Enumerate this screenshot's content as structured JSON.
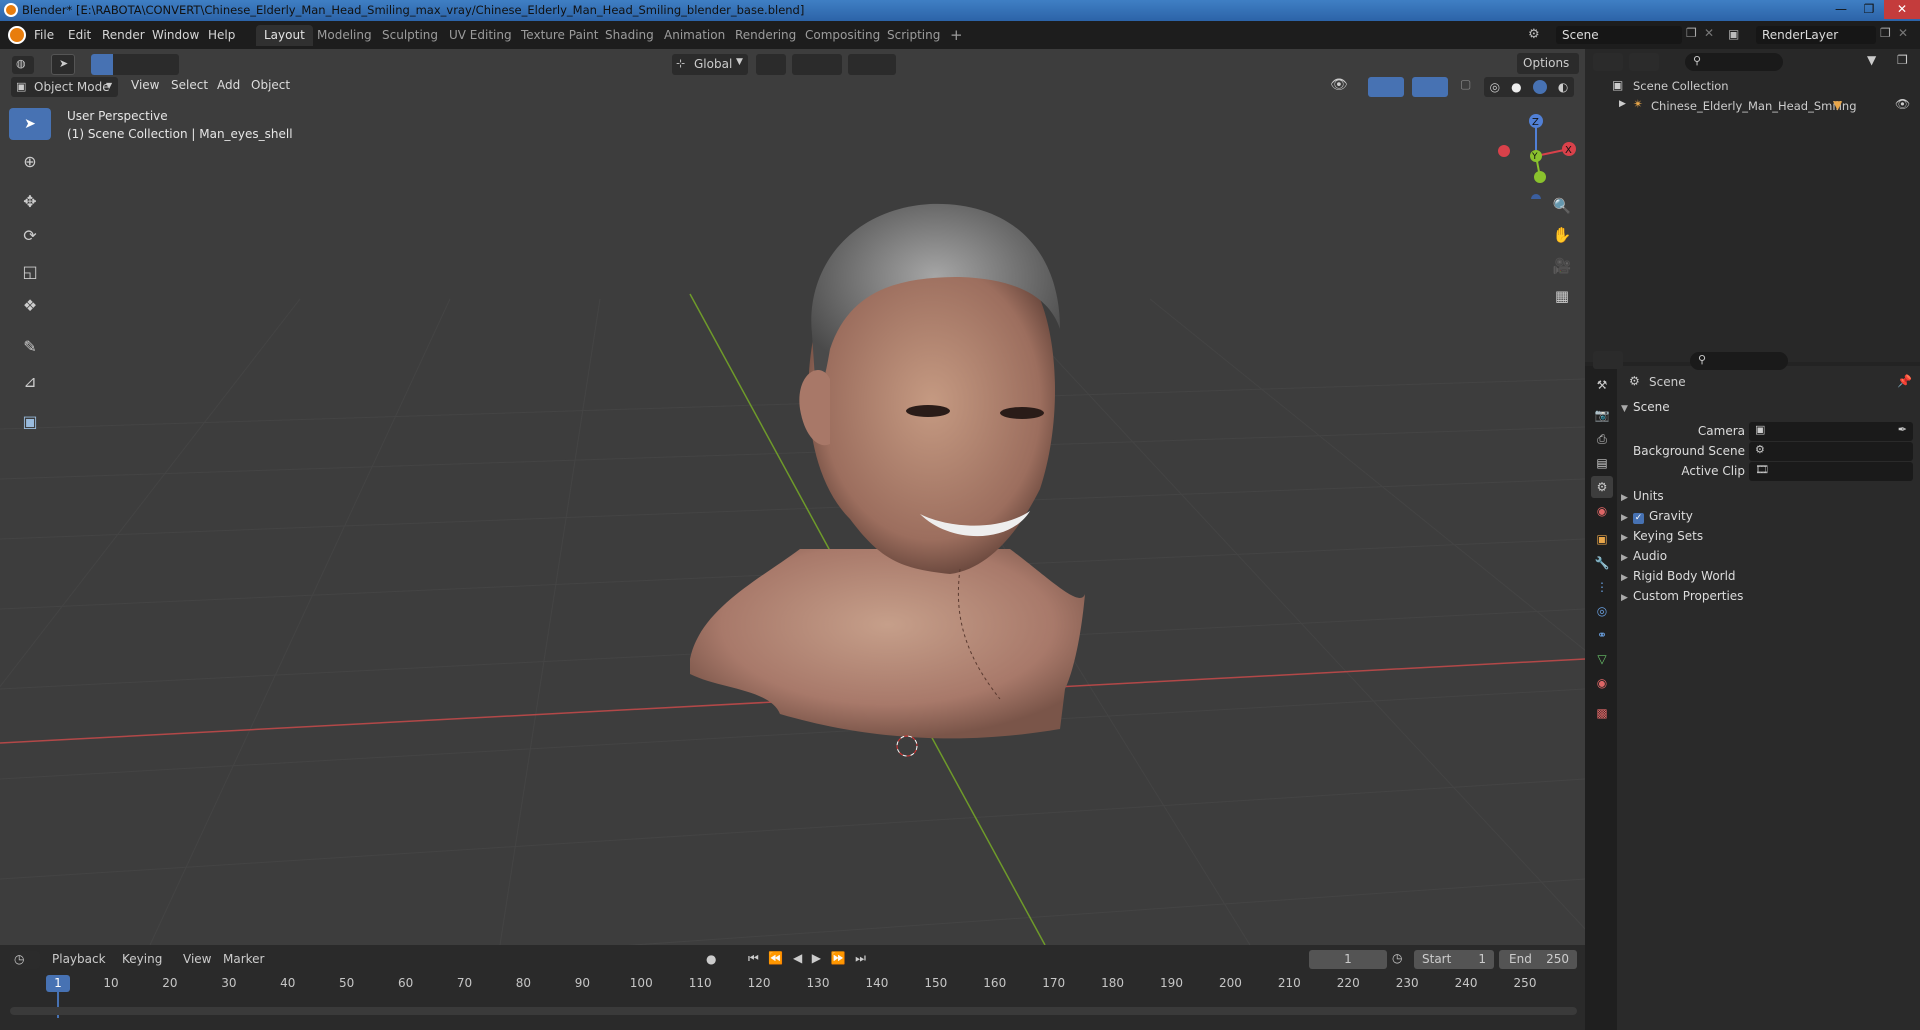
{
  "window": {
    "title": "Blender* [E:\\RABOTA\\CONVERT\\Chinese_Elderly_Man_Head_Smiling_max_vray/Chinese_Elderly_Man_Head_Smiling_blender_base.blend]"
  },
  "menu": {
    "items": [
      "File",
      "Edit",
      "Render",
      "Window",
      "Help"
    ]
  },
  "workspaces": [
    "Layout",
    "Modeling",
    "Sculpting",
    "UV Editing",
    "Texture Paint",
    "Shading",
    "Animation",
    "Rendering",
    "Compositing",
    "Scripting"
  ],
  "active_workspace": "Layout",
  "scene_selector": {
    "value": "Scene"
  },
  "renderlayer_selector": {
    "value": "RenderLayer"
  },
  "viewport": {
    "mode": "Object Mode",
    "menus": [
      "View",
      "Select",
      "Add",
      "Object"
    ],
    "orientation": "Global",
    "options_label": "Options",
    "perspective_label": "User Perspective",
    "collection_label": "(1) Scene Collection | Man_eyes_shell",
    "gizmo_axes": [
      "Z",
      "Y",
      "X"
    ]
  },
  "outliner": {
    "root": "Scene Collection",
    "items": [
      "Chinese_Elderly_Man_Head_Smiling"
    ]
  },
  "properties": {
    "header": "Scene",
    "section": "Scene",
    "fields": [
      {
        "label": "Camera"
      },
      {
        "label": "Background Scene"
      },
      {
        "label": "Active Clip"
      }
    ],
    "panels": [
      "Units",
      "Gravity",
      "Keying Sets",
      "Audio",
      "Rigid Body World",
      "Custom Properties"
    ],
    "gravity_checked": true
  },
  "timeline": {
    "menus": [
      "Playback",
      "Keying",
      "View",
      "Marker"
    ],
    "current_frame": "1",
    "start_label": "Start",
    "start_value": "1",
    "end_label": "End",
    "end_value": "250",
    "ticks": [
      "1",
      "10",
      "20",
      "30",
      "40",
      "50",
      "60",
      "70",
      "80",
      "90",
      "100",
      "110",
      "120",
      "130",
      "140",
      "150",
      "160",
      "170",
      "180",
      "190",
      "200",
      "210",
      "220",
      "230",
      "240",
      "250"
    ]
  },
  "colors": {
    "accent": "#4772b3",
    "viewport_bg": "#3d3d3d",
    "x_axis": "#b34848",
    "y_axis": "#6e9a2a"
  }
}
